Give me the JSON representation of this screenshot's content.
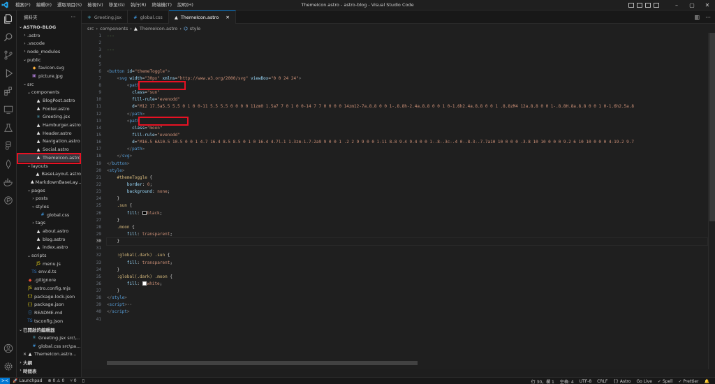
{
  "window": {
    "title": "ThemeIcon.astro - astro-blog - Visual Studio Code",
    "menu": [
      "檔案(F)",
      "編輯(E)",
      "選取項目(S)",
      "檢視(V)",
      "移至(G)",
      "執行(R)",
      "終端機(T)",
      "說明(H)"
    ]
  },
  "sidebar": {
    "title": "資料夾",
    "more": "⋯",
    "tree": [
      {
        "label": "ASTRO-BLOG",
        "depth": 0,
        "chev": "⌄",
        "icon": "",
        "bold": true
      },
      {
        "label": ".astro",
        "depth": 1,
        "chev": "›",
        "icon": ""
      },
      {
        "label": ".vscode",
        "depth": 1,
        "chev": "›",
        "icon": ""
      },
      {
        "label": "node_modules",
        "depth": 1,
        "chev": "›",
        "icon": ""
      },
      {
        "label": "public",
        "depth": 1,
        "chev": "⌄",
        "icon": ""
      },
      {
        "label": "favicon.svg",
        "depth": 2,
        "chev": "",
        "icon": "◆",
        "iconColor": "#ffb13b"
      },
      {
        "label": "picture.jpg",
        "depth": 2,
        "chev": "",
        "icon": "▣",
        "iconColor": "#a074c4"
      },
      {
        "label": "src",
        "depth": 1,
        "chev": "⌄",
        "icon": ""
      },
      {
        "label": "components",
        "depth": 2,
        "chev": "⌄",
        "icon": ""
      },
      {
        "label": "BlogPost.astro",
        "depth": 3,
        "chev": "",
        "icon": "▲",
        "iconColor": "#e8e8e8"
      },
      {
        "label": "Footer.astro",
        "depth": 3,
        "chev": "",
        "icon": "▲",
        "iconColor": "#e8e8e8"
      },
      {
        "label": "Greeting.jsx",
        "depth": 3,
        "chev": "",
        "icon": "⚛",
        "iconColor": "#61dafb"
      },
      {
        "label": "Hamburger.astro",
        "depth": 3,
        "chev": "",
        "icon": "▲",
        "iconColor": "#e8e8e8"
      },
      {
        "label": "Header.astro",
        "depth": 3,
        "chev": "",
        "icon": "▲",
        "iconColor": "#e8e8e8"
      },
      {
        "label": "Navigation.astro",
        "depth": 3,
        "chev": "",
        "icon": "▲",
        "iconColor": "#e8e8e8"
      },
      {
        "label": "Social.astro",
        "depth": 3,
        "chev": "",
        "icon": "▲",
        "iconColor": "#e8e8e8"
      },
      {
        "label": "ThemeIcon.astro",
        "depth": 3,
        "chev": "",
        "icon": "▲",
        "iconColor": "#e8e8e8",
        "selected": true
      },
      {
        "label": "layouts",
        "depth": 2,
        "chev": "⌄",
        "icon": ""
      },
      {
        "label": "BaseLayout.astro",
        "depth": 3,
        "chev": "",
        "icon": "▲",
        "iconColor": "#e8e8e8"
      },
      {
        "label": "MarkdownBaseLay...",
        "depth": 3,
        "chev": "",
        "icon": "▲",
        "iconColor": "#e8e8e8"
      },
      {
        "label": "pages",
        "depth": 2,
        "chev": "⌄",
        "icon": ""
      },
      {
        "label": "posts",
        "depth": 3,
        "chev": "›",
        "icon": ""
      },
      {
        "label": "styles",
        "depth": 3,
        "chev": "⌄",
        "icon": ""
      },
      {
        "label": "global.css",
        "depth": 4,
        "chev": "",
        "icon": "#",
        "iconColor": "#42a5f5"
      },
      {
        "label": "tags",
        "depth": 3,
        "chev": "›",
        "icon": ""
      },
      {
        "label": "about.astro",
        "depth": 3,
        "chev": "",
        "icon": "▲",
        "iconColor": "#e8e8e8"
      },
      {
        "label": "blog.astro",
        "depth": 3,
        "chev": "",
        "icon": "▲",
        "iconColor": "#e8e8e8"
      },
      {
        "label": "index.astro",
        "depth": 3,
        "chev": "",
        "icon": "▲",
        "iconColor": "#e8e8e8"
      },
      {
        "label": "scripts",
        "depth": 2,
        "chev": "⌄",
        "icon": ""
      },
      {
        "label": "menu.js",
        "depth": 3,
        "chev": "",
        "icon": "JS",
        "iconColor": "#f5de19"
      },
      {
        "label": "env.d.ts",
        "depth": 2,
        "chev": "",
        "icon": "TS",
        "iconColor": "#3178c6"
      },
      {
        "label": ".gitignore",
        "depth": 1,
        "chev": "",
        "icon": "◆",
        "iconColor": "#f05033"
      },
      {
        "label": "astro.config.mjs",
        "depth": 1,
        "chev": "",
        "icon": "JS",
        "iconColor": "#f5de19"
      },
      {
        "label": "package-lock.json",
        "depth": 1,
        "chev": "",
        "icon": "{}",
        "iconColor": "#f5de19"
      },
      {
        "label": "package.json",
        "depth": 1,
        "chev": "",
        "icon": "{}",
        "iconColor": "#f5de19"
      },
      {
        "label": "README.md",
        "depth": 1,
        "chev": "",
        "icon": "ⓘ",
        "iconColor": "#42a5f5"
      },
      {
        "label": "tsconfig.json",
        "depth": 1,
        "chev": "",
        "icon": "TS",
        "iconColor": "#3178c6"
      },
      {
        "label": "已開啟的編輯器",
        "depth": 0,
        "chev": "⌄",
        "icon": "",
        "bold": true
      },
      {
        "label": "Greeting.jsx  src\\...",
        "depth": 2,
        "chev": "",
        "icon": "⚛",
        "iconColor": "#61dafb"
      },
      {
        "label": "global.css  src\\pa...",
        "depth": 2,
        "chev": "",
        "icon": "#",
        "iconColor": "#42a5f5"
      },
      {
        "label": "ThemeIcon.astro...",
        "depth": 1,
        "chev": "✕",
        "icon": "▲",
        "iconColor": "#e8e8e8",
        "active": true
      },
      {
        "label": "大綱",
        "depth": 0,
        "chev": "›",
        "icon": "",
        "bold": true
      },
      {
        "label": "時間表",
        "depth": 0,
        "chev": "›",
        "icon": "",
        "bold": true
      }
    ]
  },
  "tabs": [
    {
      "label": "Greeting.jsx",
      "icon": "⚛",
      "iconColor": "#61dafb",
      "active": false
    },
    {
      "label": "global.css",
      "icon": "#",
      "iconColor": "#42a5f5",
      "active": false
    },
    {
      "label": "ThemeIcon.astro",
      "icon": "▲",
      "iconColor": "#e8e8e8",
      "active": true,
      "close": "✕"
    }
  ],
  "breadcrumb": {
    "parts": [
      "src",
      "components",
      "ThemeIcon.astro",
      "style"
    ],
    "sep": "›"
  },
  "editor": {
    "current_line": 30,
    "lines": [
      [
        [
          "t-com",
          "---"
        ]
      ],
      [],
      [
        [
          "t-com",
          "---"
        ]
      ],
      [],
      [],
      [
        [
          "t-br",
          "<"
        ],
        [
          "t-tag",
          "button"
        ],
        [
          "t-punc",
          " "
        ],
        [
          "t-attr",
          "id"
        ],
        [
          "t-punc",
          "="
        ],
        [
          "t-str",
          "\"themeToggle\""
        ],
        [
          "t-br",
          ">"
        ]
      ],
      [
        [
          "t-punc",
          "    "
        ],
        [
          "t-br",
          "<"
        ],
        [
          "t-tag",
          "svg"
        ],
        [
          "t-punc",
          " "
        ],
        [
          "t-attr",
          "width"
        ],
        [
          "t-punc",
          "="
        ],
        [
          "t-str",
          "\"30px\""
        ],
        [
          "t-punc",
          " "
        ],
        [
          "t-attr",
          "xmlns"
        ],
        [
          "t-punc",
          "="
        ],
        [
          "t-str",
          "\"http://www.w3.org/2000/svg\""
        ],
        [
          "t-punc",
          " "
        ],
        [
          "t-attr",
          "viewBox"
        ],
        [
          "t-punc",
          "="
        ],
        [
          "t-str",
          "\"0 0 24 24\""
        ],
        [
          "t-br",
          ">"
        ]
      ],
      [
        [
          "t-punc",
          "        "
        ],
        [
          "t-br",
          "<"
        ],
        [
          "t-tag",
          "path"
        ]
      ],
      [
        [
          "t-punc",
          "          "
        ],
        [
          "t-attr",
          "class"
        ],
        [
          "t-punc",
          "="
        ],
        [
          "t-str",
          "\"sun\""
        ]
      ],
      [
        [
          "t-punc",
          "          "
        ],
        [
          "t-attr",
          "fill-rule"
        ],
        [
          "t-punc",
          "="
        ],
        [
          "t-str",
          "\"evenodd\""
        ]
      ],
      [
        [
          "t-punc",
          "          "
        ],
        [
          "t-attr",
          "d"
        ],
        [
          "t-punc",
          "="
        ],
        [
          "t-str",
          "\"M12 17.5a5.5 5.5 0 1 0 0-11 5.5 5.5 0 0 0 0 11zm0 1.5a7 7 0 1 0 0-14 7 7 0 0 0 0 14zm12-7a.8.8 0 0 1-.8.8h-2.4a.8.8 0 0 1 0-1.6h2.4a.8.8 0 0 1 .8.8zM4 12a.8.8 0 0 1-.8.8H.8a.8.8 0 0 1 0-1.6h2.5a.8"
        ]
      ],
      [
        [
          "t-punc",
          "        "
        ],
        [
          "t-br",
          "</"
        ],
        [
          "t-tag",
          "path"
        ],
        [
          "t-br",
          ">"
        ]
      ],
      [
        [
          "t-punc",
          "        "
        ],
        [
          "t-br",
          "<"
        ],
        [
          "t-tag",
          "path"
        ]
      ],
      [
        [
          "t-punc",
          "          "
        ],
        [
          "t-attr",
          "class"
        ],
        [
          "t-punc",
          "="
        ],
        [
          "t-str",
          "\"moon\""
        ]
      ],
      [
        [
          "t-punc",
          "          "
        ],
        [
          "t-attr",
          "fill-rule"
        ],
        [
          "t-punc",
          "="
        ],
        [
          "t-str",
          "\"evenodd\""
        ]
      ],
      [
        [
          "t-punc",
          "          "
        ],
        [
          "t-attr",
          "d"
        ],
        [
          "t-punc",
          "="
        ],
        [
          "t-str",
          "\"M16.5 6A10.5 10.5 0 0 1 4.7 16.4 8.5 8.5 0 1 0 16.4 4.7l.1 1.3zm-1.7-2a9 9 0 0 1 .2 2 9 9 0 0 1-11 8.8 9.4 9.4 0 0 1-.8-.3c-.4 0-.8.3-.7.7a10 10 0 0 0 .3.8 10 10 0 0 0 9.2 6 10 10 0 0 0 4-19.2 9.7"
        ]
      ],
      [
        [
          "t-punc",
          "        "
        ],
        [
          "t-br",
          "</"
        ],
        [
          "t-tag",
          "path"
        ],
        [
          "t-br",
          ">"
        ]
      ],
      [
        [
          "t-punc",
          "    "
        ],
        [
          "t-br",
          "</"
        ],
        [
          "t-tag",
          "svg"
        ],
        [
          "t-br",
          ">"
        ]
      ],
      [
        [
          "t-br",
          "</"
        ],
        [
          "t-tag",
          "button"
        ],
        [
          "t-br",
          ">"
        ]
      ],
      [
        [
          "t-br",
          "<"
        ],
        [
          "t-tag",
          "style"
        ],
        [
          "t-br",
          ">"
        ]
      ],
      [
        [
          "t-punc",
          "    "
        ],
        [
          "t-sel",
          "#themeToggle"
        ],
        [
          "t-punc",
          " {"
        ]
      ],
      [
        [
          "t-punc",
          "        "
        ],
        [
          "t-prop",
          "border"
        ],
        [
          "t-punc",
          ": "
        ],
        [
          "t-val",
          "0"
        ],
        [
          "t-punc",
          ";"
        ]
      ],
      [
        [
          "t-punc",
          "        "
        ],
        [
          "t-prop",
          "background"
        ],
        [
          "t-punc",
          ": "
        ],
        [
          "t-val",
          "none"
        ],
        [
          "t-punc",
          ";"
        ]
      ],
      [
        [
          "t-punc",
          "    }"
        ]
      ],
      [
        [
          "t-punc",
          "    "
        ],
        [
          "t-sel",
          ".sun"
        ],
        [
          "t-punc",
          " {"
        ]
      ],
      [
        [
          "t-punc",
          "        "
        ],
        [
          "t-prop",
          "fill"
        ],
        [
          "t-punc",
          ": "
        ],
        [
          "swatch",
          "#000000"
        ],
        [
          "t-val",
          "black"
        ],
        [
          "t-punc",
          ";"
        ]
      ],
      [
        [
          "t-punc",
          "    }"
        ]
      ],
      [
        [
          "t-punc",
          "    "
        ],
        [
          "t-sel",
          ".moon"
        ],
        [
          "t-punc",
          " {"
        ]
      ],
      [
        [
          "t-punc",
          "        "
        ],
        [
          "t-prop",
          "fill"
        ],
        [
          "t-punc",
          ": "
        ],
        [
          "t-val",
          "transparent"
        ],
        [
          "t-punc",
          ";"
        ]
      ],
      [
        [
          "t-punc",
          "    }"
        ]
      ],
      [],
      [
        [
          "t-punc",
          "    "
        ],
        [
          "t-sel",
          ":global(.dark) .sun"
        ],
        [
          "t-punc",
          " {"
        ]
      ],
      [
        [
          "t-punc",
          "        "
        ],
        [
          "t-prop",
          "fill"
        ],
        [
          "t-punc",
          ": "
        ],
        [
          "t-val",
          "transparent"
        ],
        [
          "t-punc",
          ";"
        ]
      ],
      [
        [
          "t-punc",
          "    }"
        ]
      ],
      [
        [
          "t-punc",
          "    "
        ],
        [
          "t-sel",
          ":global(.dark) .moon"
        ],
        [
          "t-punc",
          " {"
        ]
      ],
      [
        [
          "t-punc",
          "        "
        ],
        [
          "t-prop",
          "fill"
        ],
        [
          "t-punc",
          ": "
        ],
        [
          "swatch",
          "#ffffff"
        ],
        [
          "t-val",
          "white"
        ],
        [
          "t-punc",
          ";"
        ]
      ],
      [
        [
          "t-punc",
          "    }"
        ]
      ],
      [
        [
          "t-br",
          "</"
        ],
        [
          "t-tag",
          "style"
        ],
        [
          "t-br",
          ">"
        ]
      ],
      [
        [
          "t-br",
          "<"
        ],
        [
          "t-tag",
          "script"
        ],
        [
          "t-br",
          ">"
        ],
        [
          "t-punc",
          "··"
        ]
      ],
      [
        [
          "t-br",
          "</"
        ],
        [
          "t-tag",
          "script"
        ],
        [
          "t-br",
          ">"
        ]
      ],
      []
    ]
  },
  "statusbar": {
    "remote": "><",
    "launchpad": "Launchpad",
    "problems": "⊗ 0 ⚠ 0",
    "ports": "⑂ 0",
    "right": [
      "行 30，欄 1",
      "空格: 4",
      "UTF-8",
      "CRLF",
      "{} Astro",
      "Go Live",
      "✓ Spell",
      "✓ Prettier",
      "🔔"
    ]
  },
  "colors": {
    "accent": "#0078d4",
    "highlight_box": "#e81123"
  }
}
